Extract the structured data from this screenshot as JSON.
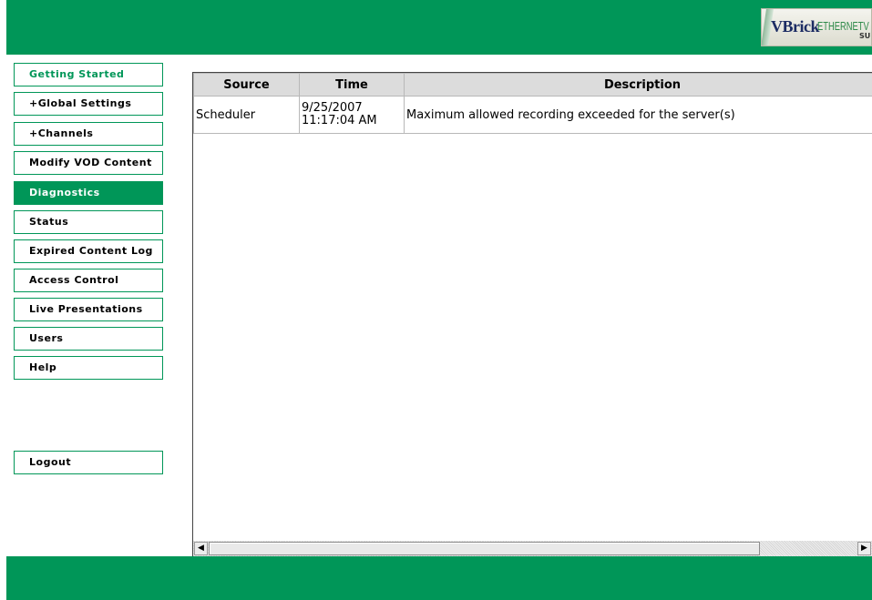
{
  "header": {
    "logo": {
      "brand": "VBrick",
      "product": "ETHERNETV",
      "suffix": "SUITE"
    }
  },
  "sidebar": {
    "items": [
      {
        "label": "Getting Started"
      },
      {
        "label": "+Global Settings"
      },
      {
        "label": "+Channels"
      },
      {
        "label": "Modify VOD Content"
      },
      {
        "label": "Diagnostics"
      },
      {
        "label": "Status"
      },
      {
        "label": "Expired Content Log"
      },
      {
        "label": "Access Control"
      },
      {
        "label": "Live Presentations"
      },
      {
        "label": "Users"
      },
      {
        "label": "Help"
      }
    ],
    "logout": {
      "label": "Logout"
    }
  },
  "log_table": {
    "headers": {
      "source": "Source",
      "time": "Time",
      "description": "Description"
    },
    "rows": [
      {
        "source": "Scheduler",
        "time_date": "9/25/2007",
        "time_clock": "11:17:04 AM",
        "description": "Maximum allowed recording exceeded for the server(s)"
      }
    ]
  },
  "scrollbar": {
    "left_arrow": "◀",
    "right_arrow": "▶"
  },
  "colors": {
    "brand_green": "#009658",
    "header_gray": "#dcdcdc"
  }
}
